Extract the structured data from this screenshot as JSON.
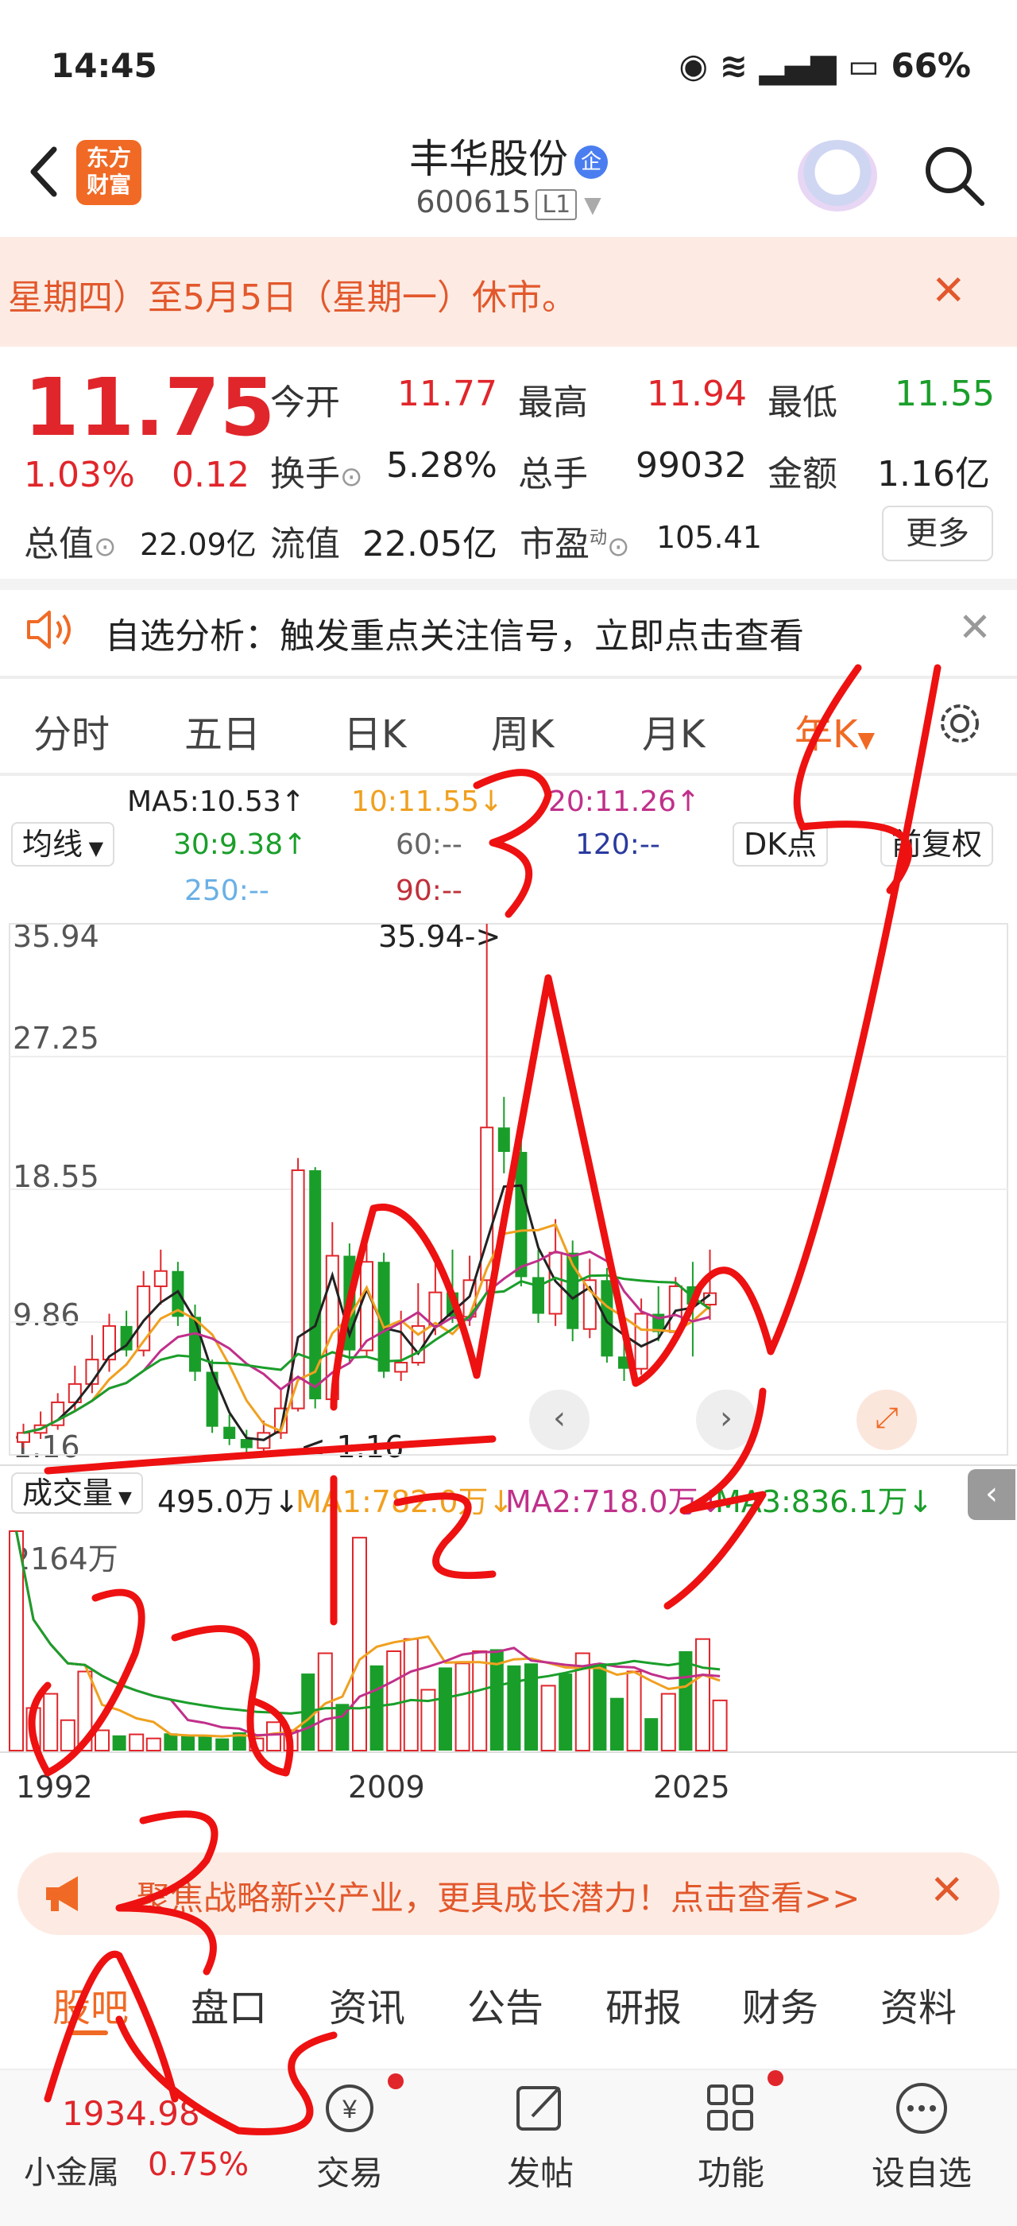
{
  "status_bar": {
    "time": "14:45",
    "battery": "66%"
  },
  "header": {
    "title": "丰华股份",
    "badge": "企",
    "code": "600615",
    "board": "L1",
    "logo_text_1": "东方",
    "logo_text_2": "财富"
  },
  "notice": {
    "text": "星期四）至5月5日（星期一）休市。"
  },
  "quote": {
    "price": "11.75",
    "change_pct": "1.03%",
    "change": "0.12",
    "rows": [
      [
        {
          "label": "今开",
          "value": "11.77",
          "color": "red"
        },
        {
          "label": "最高",
          "value": "11.94",
          "color": "red"
        },
        {
          "label": "最低",
          "value": "11.55",
          "color": "green"
        }
      ],
      [
        {
          "label": "换手",
          "value": "5.28%",
          "color": "dark"
        },
        {
          "label": "总手",
          "value": "99032",
          "color": "dark"
        },
        {
          "label": "金额",
          "value": "1.16亿",
          "color": "dark"
        }
      ]
    ],
    "row3": {
      "total_label": "总值",
      "total_value": "22.09亿",
      "float_label": "流值",
      "float_value": "22.05亿",
      "pe_label": "市盈",
      "pe_sup": "动",
      "pe_value": "105.41"
    },
    "more": "更多"
  },
  "analysis": {
    "text": "自选分析：触发重点关注信号，立即点击查看"
  },
  "period_tabs": [
    "分时",
    "五日",
    "日K",
    "周K",
    "月K",
    "年K"
  ],
  "ma": {
    "selector": "均线",
    "ma5": "MA5:10.53↑",
    "ma10": "10:11.55↓",
    "ma20": "20:11.26↑",
    "ma30": "30:9.38↑",
    "ma60": "60:--",
    "ma120": "120:--",
    "ma250": "250:--",
    "ma90": "90:--",
    "dk": "DK点",
    "fq": "前复权"
  },
  "chart_data": {
    "type": "candlestick",
    "y_ticks": [
      "35.94",
      "27.25",
      "18.55",
      "9.86",
      "1.16"
    ],
    "x_ticks": [
      "1992",
      "2009",
      "2025"
    ],
    "max_label": "35.94->",
    "min_label": "<-1.16",
    "ylim": [
      1.16,
      35.94
    ],
    "candles": [
      {
        "o": 2.0,
        "c": 2.6,
        "h": 3.2,
        "l": 1.6
      },
      {
        "o": 2.6,
        "c": 3.1,
        "h": 4.0,
        "l": 2.2
      },
      {
        "o": 3.1,
        "c": 4.6,
        "h": 5.2,
        "l": 2.8
      },
      {
        "o": 4.6,
        "c": 5.8,
        "h": 7.0,
        "l": 4.0
      },
      {
        "o": 5.8,
        "c": 7.4,
        "h": 9.0,
        "l": 5.2
      },
      {
        "o": 7.4,
        "c": 9.6,
        "h": 10.4,
        "l": 6.6
      },
      {
        "o": 9.6,
        "c": 8.0,
        "h": 10.6,
        "l": 7.6
      },
      {
        "o": 8.0,
        "c": 12.2,
        "h": 13.2,
        "l": 7.6
      },
      {
        "o": 12.2,
        "c": 13.2,
        "h": 14.6,
        "l": 11.0
      },
      {
        "o": 13.2,
        "c": 10.2,
        "h": 13.8,
        "l": 9.6
      },
      {
        "o": 10.2,
        "c": 6.6,
        "h": 11.0,
        "l": 6.0
      },
      {
        "o": 6.6,
        "c": 3.0,
        "h": 7.4,
        "l": 2.6
      },
      {
        "o": 3.0,
        "c": 2.2,
        "h": 3.8,
        "l": 1.8
      },
      {
        "o": 2.2,
        "c": 1.6,
        "h": 2.8,
        "l": 1.16
      },
      {
        "o": 1.6,
        "c": 2.6,
        "h": 3.4,
        "l": 1.4
      },
      {
        "o": 2.6,
        "c": 4.2,
        "h": 5.4,
        "l": 2.2
      },
      {
        "o": 4.2,
        "c": 19.8,
        "h": 20.6,
        "l": 4.0
      },
      {
        "o": 19.8,
        "c": 4.8,
        "h": 20.0,
        "l": 4.2
      },
      {
        "o": 4.8,
        "c": 14.2,
        "h": 16.4,
        "l": 4.4
      },
      {
        "o": 14.2,
        "c": 8.0,
        "h": 15.0,
        "l": 7.2
      },
      {
        "o": 8.0,
        "c": 13.8,
        "h": 15.2,
        "l": 7.6
      },
      {
        "o": 13.8,
        "c": 6.6,
        "h": 14.4,
        "l": 6.2
      },
      {
        "o": 6.6,
        "c": 7.2,
        "h": 10.6,
        "l": 6.0
      },
      {
        "o": 7.2,
        "c": 9.6,
        "h": 12.4,
        "l": 7.0
      },
      {
        "o": 9.6,
        "c": 11.8,
        "h": 13.8,
        "l": 9.0
      },
      {
        "o": 11.8,
        "c": 10.2,
        "h": 14.6,
        "l": 9.8
      },
      {
        "o": 10.2,
        "c": 12.6,
        "h": 14.2,
        "l": 9.6
      },
      {
        "o": 12.6,
        "c": 22.6,
        "h": 35.94,
        "l": 11.8
      },
      {
        "o": 22.6,
        "c": 21.0,
        "h": 24.6,
        "l": 19.6
      },
      {
        "o": 21.0,
        "c": 12.8,
        "h": 22.0,
        "l": 12.2
      },
      {
        "o": 12.8,
        "c": 10.4,
        "h": 14.6,
        "l": 9.8
      },
      {
        "o": 10.4,
        "c": 14.4,
        "h": 16.6,
        "l": 9.6
      },
      {
        "o": 14.4,
        "c": 9.4,
        "h": 15.2,
        "l": 8.6
      },
      {
        "o": 9.4,
        "c": 12.6,
        "h": 14.0,
        "l": 8.8
      },
      {
        "o": 12.6,
        "c": 7.6,
        "h": 13.4,
        "l": 7.2
      },
      {
        "o": 7.6,
        "c": 6.8,
        "h": 9.6,
        "l": 6.0
      },
      {
        "o": 6.8,
        "c": 10.4,
        "h": 11.4,
        "l": 6.4
      },
      {
        "o": 10.4,
        "c": 9.2,
        "h": 12.2,
        "l": 8.6
      },
      {
        "o": 9.2,
        "c": 12.2,
        "h": 12.8,
        "l": 8.8
      },
      {
        "o": 12.2,
        "c": 11.0,
        "h": 13.8,
        "l": 7.6
      },
      {
        "o": 11.0,
        "c": 11.75,
        "h": 14.6,
        "l": 10.0
      }
    ]
  },
  "volume": {
    "selector": "成交量",
    "value": "495.0万↓",
    "ma1": "MA1:782.0万↓",
    "ma2": "MA2:718.0万↓",
    "ma3": "MA3:836.1万↓",
    "top_label": "2164万",
    "bars": [
      2164,
      420,
      560,
      300,
      780,
      200,
      150,
      160,
      120,
      170,
      150,
      140,
      120,
      180,
      120,
      280,
      200,
      760,
      960,
      460,
      2100,
      840,
      980,
      1100,
      600,
      820,
      860,
      980,
      1000,
      840,
      860,
      640,
      760,
      960,
      860,
      520,
      780,
      320,
      560,
      980,
      1100,
      495
    ]
  },
  "promo": {
    "text": "聚焦战略新兴产业，更具成长潜力！点击查看>>"
  },
  "bottom_tabs": [
    "股吧",
    "盘口",
    "资讯",
    "公告",
    "研报",
    "财务",
    "资料"
  ],
  "nav": {
    "index_value": "1934.98",
    "index_name": "小金属",
    "index_pct": "0.75%",
    "trade": "交易",
    "post": "发帖",
    "func": "功能",
    "watch": "设自选"
  },
  "colors": {
    "up": "#e0262b",
    "down": "#1a9e2a",
    "accent": "#f06a25"
  }
}
